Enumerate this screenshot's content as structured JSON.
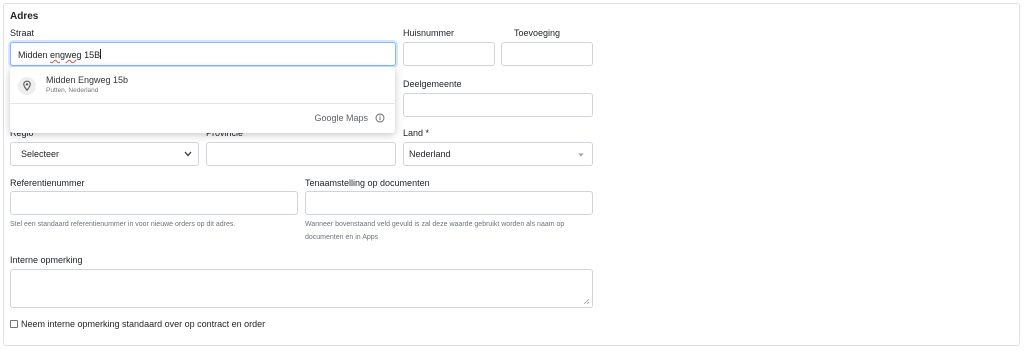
{
  "form": {
    "section_title": "Adres",
    "street": {
      "label": "Straat",
      "value_plain": "Midden ",
      "value_misspelled_1": "engweg",
      "value_end": " 15B"
    },
    "house_number": {
      "label": "Huisnummer",
      "value": ""
    },
    "addition": {
      "label": "Toevoeging",
      "value": ""
    },
    "district": {
      "label": "Deelgemeente",
      "value": ""
    },
    "region": {
      "label": "Regio",
      "selected": "Selecteer"
    },
    "province": {
      "label": "Provincie",
      "value": ""
    },
    "country": {
      "label": "Land *",
      "selected": "Nederland"
    },
    "reference": {
      "label": "Referentienummer",
      "value": "",
      "help": "Stel een standaard referentienummer in voor nieuwe orders op dit adres."
    },
    "document_name": {
      "label": "Tenaamstelling op documenten",
      "value": "",
      "help": "Wanneer bovenstaand veld gevuld is zal deze waarde gebruikt worden als naam op documenten en in Apps"
    },
    "internal_note": {
      "label": "Interne opmerking",
      "value": ""
    },
    "checkbox_label": "Neem interne opmerking standaard over op contract en order"
  },
  "autocomplete": {
    "suggestions": [
      {
        "main": "Midden Engweg 15b",
        "secondary": "Putten, Nederland",
        "icon": "location-pin-icon"
      }
    ],
    "attribution": "Google Maps"
  }
}
